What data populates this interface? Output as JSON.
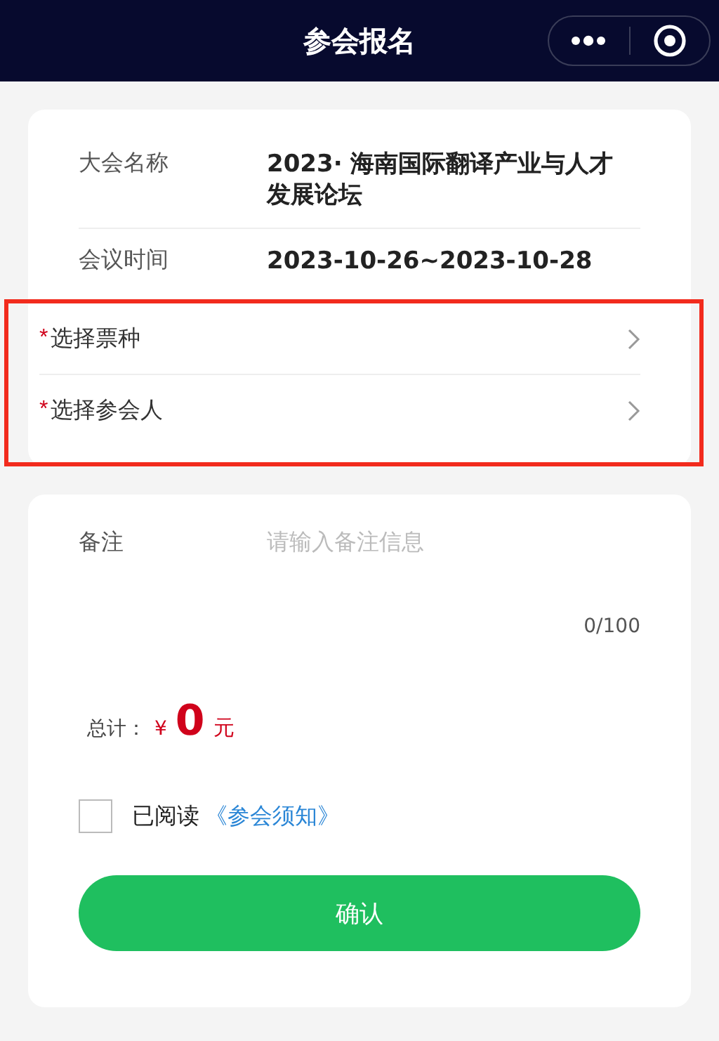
{
  "header": {
    "title": "参会报名"
  },
  "info": [
    {
      "label": "大会名称",
      "value": "2023· 海南国际翻译产业与人才发展论坛"
    },
    {
      "label": "会议时间",
      "value": "2023-10-26~2023-10-28"
    }
  ],
  "selects": {
    "highlighted": true,
    "items": [
      {
        "label": "选择票种",
        "required_mark": "*"
      },
      {
        "label": "选择参会人",
        "required_mark": "*"
      }
    ]
  },
  "remark": {
    "label": "备注",
    "placeholder": "请输入备注信息",
    "counter": "0/100"
  },
  "total": {
    "label": "总计：",
    "currency": "¥",
    "amount": "0",
    "unit": "元"
  },
  "agreement": {
    "checked": false,
    "text": "已阅读",
    "link": "《参会须知》"
  },
  "confirm_button": "确认"
}
